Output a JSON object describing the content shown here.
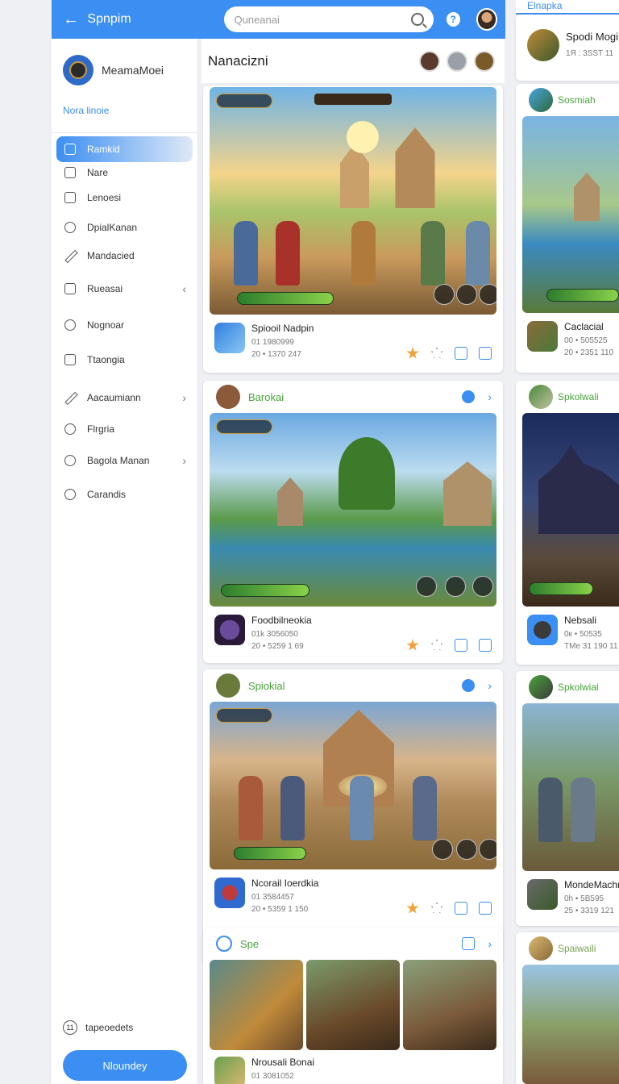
{
  "topbar": {
    "back_glyph": "←",
    "title": "Spnpim",
    "search_placeholder": "Quneanai",
    "help_glyph": "?"
  },
  "sidebar": {
    "profile_name": "MeamaMoei",
    "section_link": "Nora linoie",
    "items": [
      {
        "label": "Ramkid",
        "icon": "grid-icon",
        "active": true
      },
      {
        "label": "Nare",
        "icon": "image-icon"
      },
      {
        "label": "Lenoesi",
        "icon": "window-icon"
      },
      {
        "label": "DpialKanan",
        "icon": "gamepad-icon"
      },
      {
        "label": "Mandacied",
        "icon": "pen-icon"
      },
      {
        "label": "Rueasai",
        "icon": "folder-icon",
        "chevron": "‹"
      },
      {
        "label": "Nognoar",
        "icon": "clock-icon"
      },
      {
        "label": "Ttaongia",
        "icon": "calendar-icon"
      },
      {
        "label": "Aacaumiann",
        "icon": "link-icon",
        "chevron": "›"
      },
      {
        "label": "Flrgria",
        "icon": "user-icon"
      },
      {
        "label": "Bagola Manan",
        "icon": "settings-icon",
        "chevron": "›"
      },
      {
        "label": "Carandis",
        "icon": "compass-icon"
      }
    ],
    "footer_icon_text": "11",
    "footer_label": "tapeoedets",
    "primary_button": "Nloundey"
  },
  "main": {
    "title": "Nanacizni",
    "cards": [
      {
        "app_name": "Spiooil Nadpin",
        "line1": "01 1980999",
        "line2": "20 • 1370  247"
      },
      {
        "head": "Barokai",
        "chev": "›",
        "app_name": "Foodbilneokia",
        "line1": "01k 3056050",
        "line2": "20 • 5259 1 69"
      },
      {
        "head": "Spiokial",
        "chev": "›",
        "app_name": "Ncorail Ioerdkia",
        "line1": "01 3584457",
        "line2": "20 • 5359 1 150"
      },
      {
        "head": "Spe",
        "chev": "›",
        "app_name": "Nrousali Bonai",
        "line1": "01 3081052"
      }
    ]
  },
  "right": {
    "tab": "Elnapka",
    "cards": [
      {
        "title": "Spodi Mogi",
        "line1": "1Я : 3SST 11"
      },
      {
        "head": "Sosmiah",
        "app_name": "Caclacial",
        "line1": "00 • 505525",
        "line2": "20 • 2351 110"
      },
      {
        "head": "Spkolwali",
        "app_name": "Nebsali",
        "line1": "0к • 50535",
        "line2": "TMe 31 190 11"
      },
      {
        "head": "Spkolwial",
        "app_name": "MondeMachn",
        "line1": "0h • 5B595",
        "line2": "25 • 3319 121"
      },
      {
        "head": "Spaiwaili"
      }
    ]
  }
}
